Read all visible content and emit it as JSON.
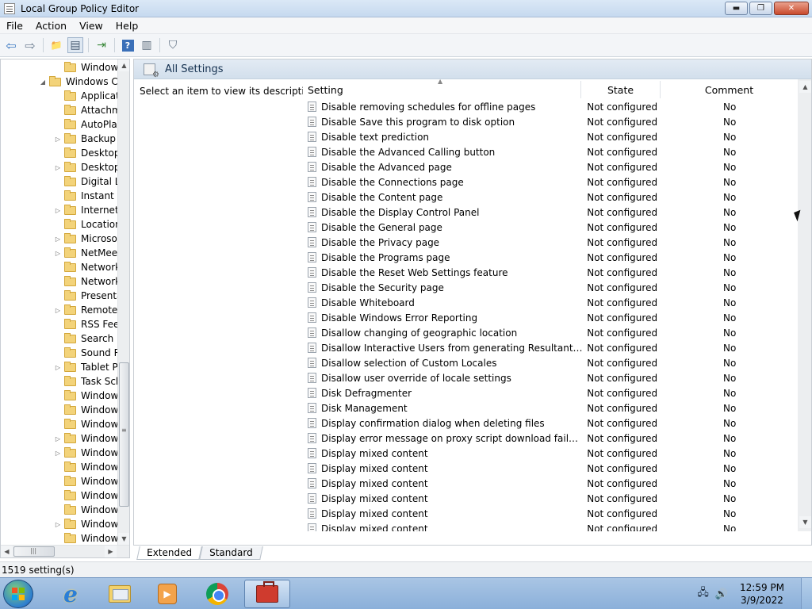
{
  "window": {
    "title": "Local Group Policy Editor",
    "minimize_glyph": "▬",
    "maximize_glyph": "❐",
    "close_glyph": "✕"
  },
  "menu": [
    "File",
    "Action",
    "Help"
  ],
  "menu_view": "View",
  "toolbar": {
    "back": "⇦",
    "forward": "⇨",
    "up_folder": "📁",
    "show_hide": "▤",
    "export": "⇥",
    "help": "?",
    "properties": "▥",
    "filter": "⛉"
  },
  "tree": {
    "items": [
      {
        "label": "Window",
        "indent": 2,
        "expander": ""
      },
      {
        "label": "Windows Co",
        "indent": 1,
        "expander": "◢"
      },
      {
        "label": "Applicat",
        "indent": 2,
        "expander": ""
      },
      {
        "label": "Attachm",
        "indent": 2,
        "expander": ""
      },
      {
        "label": "AutoPlay",
        "indent": 2,
        "expander": ""
      },
      {
        "label": "Backup",
        "indent": 2,
        "expander": "▷"
      },
      {
        "label": "Desktop",
        "indent": 2,
        "expander": ""
      },
      {
        "label": "Desktop",
        "indent": 2,
        "expander": "▷"
      },
      {
        "label": "Digital L",
        "indent": 2,
        "expander": ""
      },
      {
        "label": "Instant S",
        "indent": 2,
        "expander": ""
      },
      {
        "label": "Internet",
        "indent": 2,
        "expander": "▷"
      },
      {
        "label": "Location",
        "indent": 2,
        "expander": ""
      },
      {
        "label": "Microso",
        "indent": 2,
        "expander": "▷"
      },
      {
        "label": "NetMeet",
        "indent": 2,
        "expander": "▷"
      },
      {
        "label": "Network",
        "indent": 2,
        "expander": ""
      },
      {
        "label": "Network",
        "indent": 2,
        "expander": ""
      },
      {
        "label": "Presenta",
        "indent": 2,
        "expander": ""
      },
      {
        "label": "Remote",
        "indent": 2,
        "expander": "▷"
      },
      {
        "label": "RSS Feed",
        "indent": 2,
        "expander": ""
      },
      {
        "label": "Search",
        "indent": 2,
        "expander": ""
      },
      {
        "label": "Sound R",
        "indent": 2,
        "expander": ""
      },
      {
        "label": "Tablet P",
        "indent": 2,
        "expander": "▷"
      },
      {
        "label": "Task Sch",
        "indent": 2,
        "expander": ""
      },
      {
        "label": "Window",
        "indent": 2,
        "expander": ""
      },
      {
        "label": "Window",
        "indent": 2,
        "expander": ""
      },
      {
        "label": "Window",
        "indent": 2,
        "expander": ""
      },
      {
        "label": "Window",
        "indent": 2,
        "expander": "▷"
      },
      {
        "label": "Window",
        "indent": 2,
        "expander": "▷"
      },
      {
        "label": "Window",
        "indent": 2,
        "expander": ""
      },
      {
        "label": "Window",
        "indent": 2,
        "expander": ""
      },
      {
        "label": "Window",
        "indent": 2,
        "expander": ""
      },
      {
        "label": "Window",
        "indent": 2,
        "expander": ""
      },
      {
        "label": "Window",
        "indent": 2,
        "expander": "▷"
      },
      {
        "label": "Window",
        "indent": 2,
        "expander": ""
      }
    ],
    "scroll_up": "▲",
    "scroll_down": "▼",
    "scroll_left": "◀",
    "scroll_right": "▶",
    "grip": "≡",
    "hgrip": "|||"
  },
  "pane": {
    "header_title": "All Settings",
    "description": "Select an item to view its description."
  },
  "columns": {
    "setting": "Setting",
    "state": "State",
    "comment": "Comment",
    "sort_glyph": "▲"
  },
  "rows": [
    {
      "setting": "Disable removing schedules for offline pages",
      "state": "Not configured",
      "comment": "No"
    },
    {
      "setting": "Disable Save this program to disk option",
      "state": "Not configured",
      "comment": "No"
    },
    {
      "setting": "Disable text prediction",
      "state": "Not configured",
      "comment": "No"
    },
    {
      "setting": "Disable the Advanced Calling button",
      "state": "Not configured",
      "comment": "No"
    },
    {
      "setting": "Disable the Advanced page",
      "state": "Not configured",
      "comment": "No"
    },
    {
      "setting": "Disable the Connections page",
      "state": "Not configured",
      "comment": "No"
    },
    {
      "setting": "Disable the Content page",
      "state": "Not configured",
      "comment": "No"
    },
    {
      "setting": "Disable the Display Control Panel",
      "state": "Not configured",
      "comment": "No"
    },
    {
      "setting": "Disable the General page",
      "state": "Not configured",
      "comment": "No"
    },
    {
      "setting": "Disable the Privacy page",
      "state": "Not configured",
      "comment": "No"
    },
    {
      "setting": "Disable the Programs page",
      "state": "Not configured",
      "comment": "No"
    },
    {
      "setting": "Disable the Reset Web Settings feature",
      "state": "Not configured",
      "comment": "No"
    },
    {
      "setting": "Disable the Security page",
      "state": "Not configured",
      "comment": "No"
    },
    {
      "setting": "Disable Whiteboard",
      "state": "Not configured",
      "comment": "No"
    },
    {
      "setting": "Disable Windows Error Reporting",
      "state": "Not configured",
      "comment": "No"
    },
    {
      "setting": "Disallow changing of geographic location",
      "state": "Not configured",
      "comment": "No"
    },
    {
      "setting": "Disallow Interactive Users from generating Resultant Set of P...",
      "state": "Not configured",
      "comment": "No"
    },
    {
      "setting": "Disallow selection of Custom Locales",
      "state": "Not configured",
      "comment": "No"
    },
    {
      "setting": "Disallow user override of locale settings",
      "state": "Not configured",
      "comment": "No"
    },
    {
      "setting": "Disk Defragmenter",
      "state": "Not configured",
      "comment": "No"
    },
    {
      "setting": "Disk Management",
      "state": "Not configured",
      "comment": "No"
    },
    {
      "setting": "Display confirmation dialog when deleting files",
      "state": "Not configured",
      "comment": "No"
    },
    {
      "setting": "Display error message on proxy script download failure",
      "state": "Not configured",
      "comment": "No"
    },
    {
      "setting": "Display mixed content",
      "state": "Not configured",
      "comment": "No"
    },
    {
      "setting": "Display mixed content",
      "state": "Not configured",
      "comment": "No"
    },
    {
      "setting": "Display mixed content",
      "state": "Not configured",
      "comment": "No"
    },
    {
      "setting": "Display mixed content",
      "state": "Not configured",
      "comment": "No"
    },
    {
      "setting": "Display mixed content",
      "state": "Not configured",
      "comment": "No"
    },
    {
      "setting": "Display mixed content",
      "state": "Not configured",
      "comment": "No"
    }
  ],
  "tabs": [
    "Extended",
    "Standard"
  ],
  "status": "1519 setting(s)",
  "taskbar": {
    "ie_glyph": "e",
    "media_glyph": "▶",
    "tray_network": "🖧",
    "tray_volume": "🔊",
    "time": "12:59 PM",
    "date": "3/9/2022"
  },
  "colors": {
    "accent": "#2a7ed8",
    "taskbar": "#8bb0da"
  }
}
